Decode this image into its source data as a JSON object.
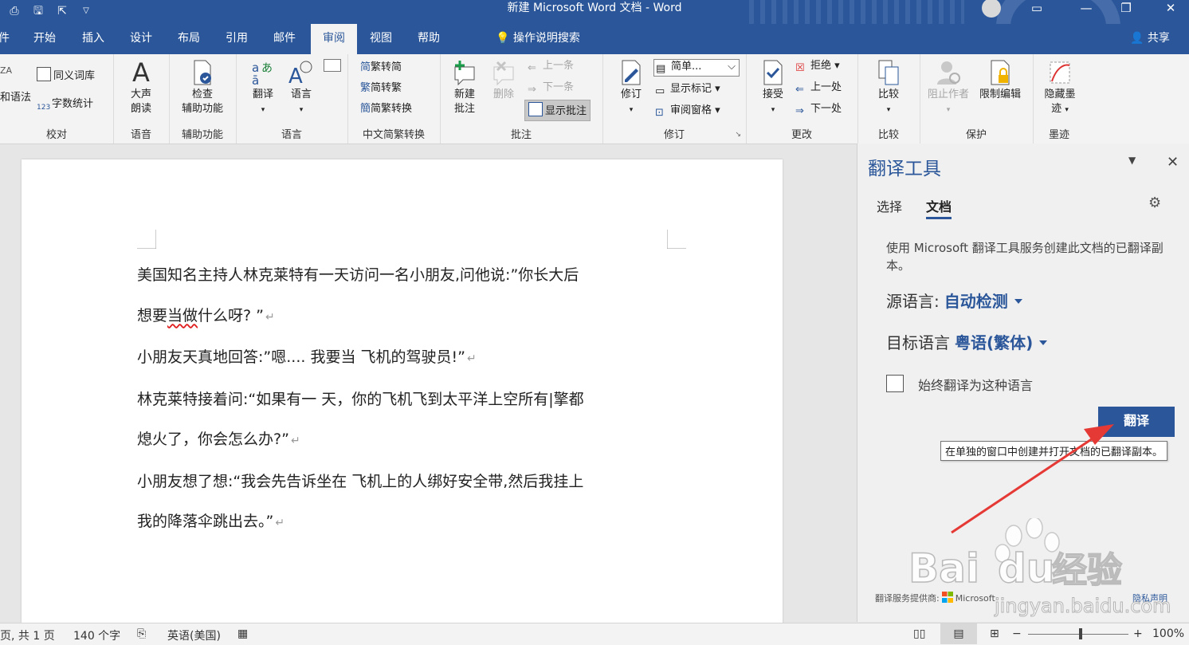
{
  "window": {
    "title": "新建 Microsoft Word 文档  -  Word",
    "controls": {
      "ribbon_options": "▭",
      "minimize": "—",
      "restore": "❐",
      "close": "✕"
    }
  },
  "tabs": [
    {
      "label": "件"
    },
    {
      "label": "开始"
    },
    {
      "label": "插入"
    },
    {
      "label": "设计"
    },
    {
      "label": "布局"
    },
    {
      "label": "引用"
    },
    {
      "label": "邮件"
    },
    {
      "label": "审阅",
      "active": true
    },
    {
      "label": "视图"
    },
    {
      "label": "帮助"
    }
  ],
  "tell_me": "操作说明搜索",
  "share": "共享",
  "ribbon": {
    "proofing": {
      "spelling": "和语法",
      "thesaurus": "同义词库",
      "wordcount": "字数统计",
      "label": "校对"
    },
    "speech": {
      "read_aloud_1": "大声",
      "read_aloud_2": "朗读",
      "label": "语音"
    },
    "accessibility": {
      "check_1": "检查",
      "check_2": "辅助功能",
      "label": "辅助功能"
    },
    "language": {
      "translate": "翻译",
      "language": "语言",
      "label": "语言"
    },
    "chinese": {
      "to_trad": "繁转简",
      "to_simp": "简转繁",
      "convert": "简繁转换",
      "label": "中文简繁转换",
      "glyph_simp": "简",
      "glyph_trad": "繁",
      "glyph_conv": "簡"
    },
    "comments": {
      "new_1": "新建",
      "new_2": "批注",
      "delete": "删除",
      "prev": "上一条",
      "next": "下一条",
      "show": "显示批注",
      "label": "批注"
    },
    "tracking": {
      "track": "修订",
      "markup_select": "简单...",
      "show_markup": "显示标记",
      "review_pane": "审阅窗格",
      "label": "修订"
    },
    "changes": {
      "accept": "接受",
      "reject": "拒绝",
      "prev": "上一处",
      "next": "下一处",
      "label": "更改"
    },
    "compare": {
      "compare": "比较",
      "label": "比较"
    },
    "protect": {
      "block": "阻止作者",
      "restrict": "限制编辑",
      "label": "保护"
    },
    "ink": {
      "hide_1": "隐藏墨",
      "hide_2": "迹",
      "label": "墨迹"
    }
  },
  "document": {
    "paragraphs": [
      {
        "text": "美国知名主持人林克莱特有一天访问一名小朋友,问他说:”你长大后",
        "mark": ""
      },
      {
        "pre": "想要",
        "squiggle": "当做",
        "post": "什么呀? ”",
        "mark": "↵"
      },
      {
        "text": "小朋友天真地回答:”嗯.... 我要当 飞机的驾驶员!”",
        "mark": "↵"
      },
      {
        "text": "林克莱特接着问:“如果有一 天，你的飞机飞到太平洋上空所有|擎都",
        "mark": ""
      },
      {
        "text": "熄火了，你会怎么办?”",
        "mark": "↵"
      },
      {
        "text": "小朋友想了想:“我会先告诉坐在 飞机上的人绑好安全带,然后我挂上",
        "mark": ""
      },
      {
        "text": "我的降落伞跳出去。”",
        "mark": "↵"
      }
    ]
  },
  "pane": {
    "title": "翻译工具",
    "tab_selection": "选择",
    "tab_document": "文档",
    "description": "使用 Microsoft 翻译工具服务创建此文档的已翻译副本。",
    "source_label": "源语言:",
    "source_value": "自动检测",
    "target_label": "目标语言",
    "target_value": "粤语(繁体)",
    "always_label": "始终翻译为这种语言",
    "translate_button": "翻译",
    "tooltip": "在单独的窗口中创建并打开文档的已翻译副本。",
    "provider": "翻译服务提供商:",
    "provider_name": "Microsoft",
    "privacy": "隐私声明"
  },
  "status": {
    "page": "页, 共 1 页",
    "words": "140 个字",
    "language": "英语(美国)",
    "zoom_minus": "−",
    "zoom_plus": "+",
    "zoom": "100%"
  },
  "watermark": {
    "brand": "Bai",
    "brand2": "du",
    "jingyan": "经验",
    "url": "jingyan.baidu.com"
  },
  "colors": {
    "accent": "#2b579a",
    "arrow": "#e53935"
  }
}
